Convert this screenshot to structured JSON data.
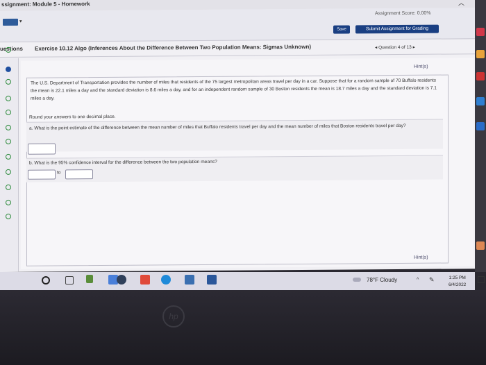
{
  "window": {
    "title": "ssignment: Module 5 - Homework"
  },
  "header": {
    "score": "Assignment Score: 0.00%",
    "save_label": "Save",
    "submit_label": "Submit Assignment for Grading"
  },
  "question_bar": {
    "questions_label": "uestions",
    "exercise_title": "Exercise 10.12 Algo (Inferences About the Difference Between Two Population Means: Sigmas Unknown)",
    "nav_label": "◂ Question 4 of 13 ▸"
  },
  "content": {
    "hint_top": "Hint(s)",
    "paragraph": "The U.S. Department of Transportation provides the number of miles that residents of the 75 largest metropolitan areas travel per day in a car. Suppose that for a random sample of 70 Buffalo residents the mean is 22.1 miles a day and the standard deviation is 8.6 miles a day, and for an independent random sample of 30 Boston residents the mean is 18.7 miles a day and the standard deviation is 7.1 miles a day.",
    "round_note": "Round your answers to one decimal place.",
    "question_a": "a. What is the point estimate of the difference between the mean number of miles that Buffalo residents travel per day and the mean number of miles that Boston residents travel per day?",
    "question_b": "b. What is the 95% confidence interval for the difference between the two population means?",
    "to_label": "to",
    "hint_bottom": "Hint(s)"
  },
  "taskbar": {
    "weather": "78°F  Cloudy",
    "time": "1:25 PM",
    "date": "6/4/2022"
  },
  "colors": {
    "button_blue": "#1a3f82",
    "dot_green": "#2b8a3a",
    "dot_active": "#1f4fa0"
  }
}
